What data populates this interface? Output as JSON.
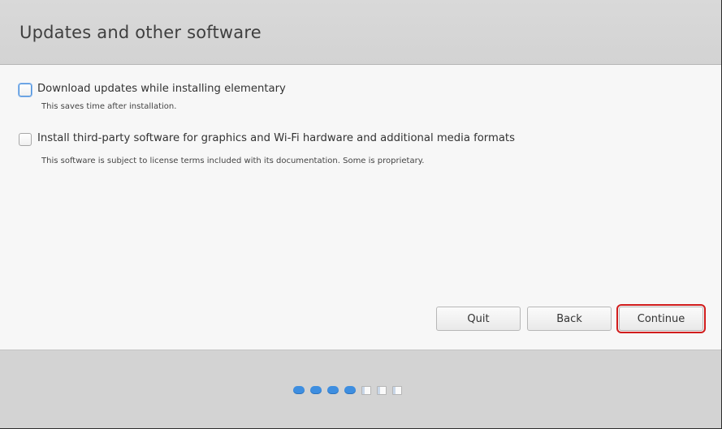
{
  "window": {
    "title": "Updates and other software"
  },
  "options": [
    {
      "label": "Download updates while installing elementary",
      "description": "This saves time after installation.",
      "checked": false,
      "focused": true
    },
    {
      "label": "Install third-party software for graphics and Wi-Fi hardware and additional media formats",
      "description": "This software is subject to license terms included with its documentation. Some is proprietary.",
      "checked": false,
      "focused": false
    }
  ],
  "buttons": {
    "quit": "Quit",
    "back": "Back",
    "continue": "Continue"
  },
  "progress": {
    "completed_steps": 4,
    "total_steps": 7
  },
  "colors": {
    "accent": "#3e8ee0",
    "focus_highlight": "#d11d1d"
  }
}
